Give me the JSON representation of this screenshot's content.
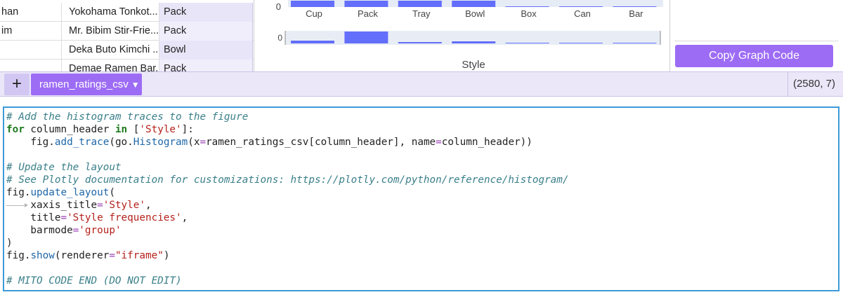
{
  "grid": {
    "rows": [
      {
        "c0": "han",
        "c1": "Yokohama Tonkot...",
        "c2": "Pack"
      },
      {
        "c0": "im",
        "c1": "Mr. Bibim Stir-Frie...",
        "c2": "Pack"
      },
      {
        "c0": "",
        "c1": "Deka Buto Kimchi ...",
        "c2": "Bowl"
      },
      {
        "c0": "",
        "c1": "Demae Ramen Bar...",
        "c2": "Pack"
      }
    ]
  },
  "chart_data": {
    "type": "bar",
    "title": "",
    "xlabel": "Style",
    "ylabel": "",
    "categories": [
      "Cup",
      "Pack",
      "Tray",
      "Bowl",
      "Box",
      "Can",
      "Bar"
    ],
    "y_tick_label_top": "0",
    "y_tick_label_mini": "0",
    "colors": {
      "bar": "#636efa",
      "plot_bg": "#e5ecf6",
      "range_bg": "#e8edf5"
    }
  },
  "side_panel": {
    "copy_button_label": "Copy Graph Code"
  },
  "tabbar": {
    "add_button_label": "+",
    "sheet_tab_label": "ramen_ratings_csv",
    "sheet_shape": "(2580, 7)"
  },
  "code_lines": [
    [
      {
        "t": "# Add the histogram traces to the figure",
        "c": "cm"
      }
    ],
    [
      {
        "t": "for",
        "c": "kw"
      },
      {
        "t": " column_header "
      },
      {
        "t": "in",
        "c": "kw"
      },
      {
        "t": " ["
      },
      {
        "t": "'Style'",
        "c": "st"
      },
      {
        "t": "]:"
      }
    ],
    [
      {
        "t": "    fig."
      },
      {
        "t": "add_trace",
        "c": "fn"
      },
      {
        "t": "(go."
      },
      {
        "t": "Histogram",
        "c": "fn"
      },
      {
        "t": "(x"
      },
      {
        "t": "=",
        "c": "op"
      },
      {
        "t": "ramen_ratings_csv[column_header], name"
      },
      {
        "t": "=",
        "c": "op"
      },
      {
        "t": "column_header))"
      }
    ],
    [],
    [
      {
        "t": "# Update the layout",
        "c": "cm"
      }
    ],
    [
      {
        "t": "# See Plotly documentation for customizations: https://plotly.com/python/reference/histogram/",
        "c": "cm"
      }
    ],
    [
      {
        "t": "fig."
      },
      {
        "t": "update_layout",
        "c": "fn"
      },
      {
        "t": "("
      }
    ],
    [
      {
        "t": "    xaxis_title"
      },
      {
        "t": "=",
        "c": "op"
      },
      {
        "t": "'Style'",
        "c": "st"
      },
      {
        "t": ","
      }
    ],
    [
      {
        "t": "    title"
      },
      {
        "t": "=",
        "c": "op"
      },
      {
        "t": "'Style frequencies'",
        "c": "st"
      },
      {
        "t": ","
      }
    ],
    [
      {
        "t": "    barmode"
      },
      {
        "t": "=",
        "c": "op"
      },
      {
        "t": "'group'",
        "c": "st"
      }
    ],
    [
      {
        "t": ")"
      }
    ],
    [
      {
        "t": "fig."
      },
      {
        "t": "show",
        "c": "fn"
      },
      {
        "t": "(renderer"
      },
      {
        "t": "=",
        "c": "op"
      },
      {
        "t": "\"iframe\"",
        "c": "st"
      },
      {
        "t": ")"
      }
    ],
    [],
    [
      {
        "t": "# MITO CODE END (DO NOT EDIT)",
        "c": "cm"
      }
    ]
  ]
}
